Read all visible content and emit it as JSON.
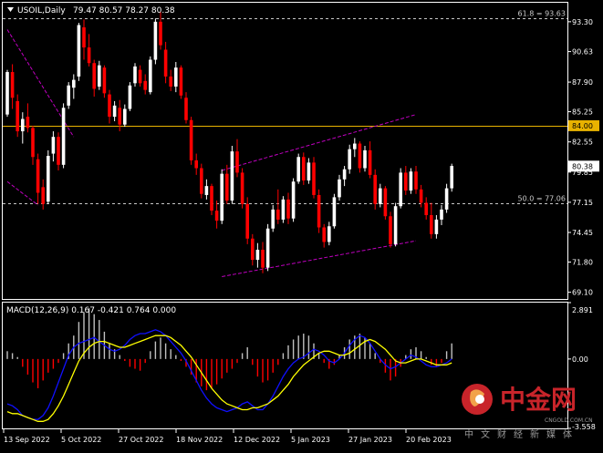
{
  "colors": {
    "background": "#000000",
    "frame": "#ffffff",
    "bull": "#ffffff",
    "bear": "#ff0000",
    "horizontal_level": "#e8b200",
    "fib_level": "#c8c8c8",
    "channel": "#c000c0",
    "macd_histogram": "#c0c0c0",
    "macd_hist_negative": "#ff0000",
    "macd_line": "#1010ff",
    "signal_line": "#ffff00",
    "axis_text": "#ffffff",
    "price_label_bg": "#ffffff",
    "level_label_bg": "#e8b200",
    "watermark_red": "#c8242a",
    "watermark_gray": "#9a9a9a"
  },
  "chart_data": [
    {
      "type": "candlestick",
      "symbol_header": "USOIL,Daily",
      "ohlc_header": "79.47 80.57 78.27 80.38",
      "yaxis_ticks": [
        "93.30",
        "90.63",
        "87.90",
        "85.25",
        "82.55",
        "79.85",
        "77.15",
        "74.45",
        "71.80",
        "69.10"
      ],
      "ylim": [
        68.5,
        95.0
      ],
      "xaxis_ticks": [
        "13 Sep 2022",
        "5 Oct 2022",
        "27 Oct 2022",
        "18 Nov 2022",
        "12 Dec 2022",
        "5 Jan 2023",
        "27 Jan 2023",
        "20 Feb 2023"
      ],
      "current_price": "80.38",
      "horizontal_levels": [
        {
          "value": 84.0,
          "label": "84.00",
          "style": "solid"
        },
        {
          "value": 93.63,
          "label": "61.8 = 93.63",
          "style": "dashed"
        },
        {
          "value": 77.06,
          "label": "50.0 = 77.06",
          "style": "dashed"
        }
      ],
      "candles": [
        [
          85.0,
          89.0,
          84.8,
          88.8
        ],
        [
          88.8,
          89.5,
          85.5,
          86.5
        ],
        [
          86.2,
          86.8,
          83.0,
          83.5
        ],
        [
          83.5,
          85.2,
          82.4,
          84.6
        ],
        [
          84.8,
          86.0,
          83.4,
          83.8
        ],
        [
          83.8,
          84.0,
          80.5,
          81.2
        ],
        [
          81.0,
          81.5,
          77.0,
          78.0
        ],
        [
          78.5,
          79.2,
          76.5,
          77.0
        ],
        [
          77.2,
          81.8,
          77.0,
          81.3
        ],
        [
          81.5,
          83.5,
          80.8,
          83.0
        ],
        [
          83.0,
          83.4,
          80.0,
          80.5
        ],
        [
          80.5,
          86.0,
          80.2,
          85.6
        ],
        [
          85.8,
          87.9,
          85.5,
          87.6
        ],
        [
          87.4,
          88.6,
          86.4,
          88.1
        ],
        [
          88.4,
          93.2,
          88.0,
          93.0
        ],
        [
          92.8,
          93.5,
          89.9,
          91.0
        ],
        [
          91.0,
          92.2,
          89.3,
          89.6
        ],
        [
          89.6,
          89.9,
          86.6,
          87.3
        ],
        [
          87.5,
          89.8,
          87.2,
          89.4
        ],
        [
          89.2,
          89.4,
          86.5,
          86.9
        ],
        [
          86.8,
          87.2,
          84.2,
          84.8
        ],
        [
          84.8,
          86.2,
          84.4,
          85.8
        ],
        [
          85.6,
          86.3,
          83.5,
          84.1
        ],
        [
          84.1,
          85.9,
          83.9,
          85.5
        ],
        [
          85.5,
          87.9,
          85.3,
          87.6
        ],
        [
          87.8,
          89.6,
          87.5,
          89.3
        ],
        [
          89.0,
          89.4,
          87.5,
          87.8
        ],
        [
          88.0,
          88.6,
          86.8,
          87.2
        ],
        [
          87.0,
          90.2,
          86.8,
          89.9
        ],
        [
          89.9,
          93.6,
          89.5,
          93.3
        ],
        [
          93.3,
          94.2,
          90.8,
          91.2
        ],
        [
          90.8,
          91.5,
          87.8,
          88.4
        ],
        [
          88.4,
          89.0,
          87.1,
          87.5
        ],
        [
          87.5,
          89.7,
          87.0,
          89.2
        ],
        [
          89.2,
          89.4,
          86.4,
          86.7
        ],
        [
          86.5,
          87.0,
          84.2,
          84.5
        ],
        [
          84.5,
          84.8,
          80.5,
          80.9
        ],
        [
          80.9,
          81.5,
          79.6,
          80.2
        ],
        [
          80.2,
          80.6,
          77.5,
          77.9
        ],
        [
          77.8,
          79.2,
          77.4,
          78.6
        ],
        [
          78.6,
          78.8,
          76.0,
          76.4
        ],
        [
          76.4,
          77.3,
          74.8,
          75.5
        ],
        [
          75.5,
          80.1,
          75.2,
          79.7
        ],
        [
          79.7,
          80.5,
          77.0,
          77.3
        ],
        [
          77.3,
          82.2,
          77.0,
          81.7
        ],
        [
          81.7,
          82.8,
          79.4,
          79.8
        ],
        [
          79.8,
          80.2,
          76.6,
          77.0
        ],
        [
          77.0,
          77.6,
          73.4,
          73.9
        ],
        [
          73.9,
          74.3,
          71.5,
          72.0
        ],
        [
          72.0,
          73.5,
          71.3,
          72.9
        ],
        [
          72.9,
          73.6,
          70.8,
          71.3
        ],
        [
          71.3,
          75.2,
          71.0,
          74.8
        ],
        [
          74.8,
          76.9,
          74.5,
          76.5
        ],
        [
          76.5,
          78.3,
          75.2,
          75.6
        ],
        [
          75.6,
          77.7,
          75.3,
          77.4
        ],
        [
          77.4,
          78.0,
          75.2,
          75.7
        ],
        [
          75.7,
          79.3,
          75.4,
          79.0
        ],
        [
          79.0,
          81.5,
          78.8,
          81.2
        ],
        [
          81.2,
          81.6,
          78.7,
          79.1
        ],
        [
          79.1,
          81.1,
          78.8,
          80.7
        ],
        [
          80.7,
          81.2,
          77.5,
          77.8
        ],
        [
          77.8,
          78.3,
          74.4,
          74.9
        ],
        [
          74.9,
          75.2,
          73.1,
          73.6
        ],
        [
          73.6,
          75.4,
          73.3,
          75.0
        ],
        [
          75.0,
          77.9,
          74.8,
          77.6
        ],
        [
          77.6,
          79.6,
          77.3,
          79.2
        ],
        [
          79.2,
          80.4,
          78.6,
          80.1
        ],
        [
          80.1,
          82.3,
          79.7,
          81.9
        ],
        [
          81.9,
          82.9,
          81.2,
          82.4
        ],
        [
          82.4,
          82.6,
          79.8,
          80.2
        ],
        [
          80.2,
          82.2,
          79.9,
          81.8
        ],
        [
          81.8,
          82.6,
          79.3,
          79.6
        ],
        [
          79.6,
          80.1,
          76.5,
          77.0
        ],
        [
          77.0,
          78.8,
          76.7,
          78.4
        ],
        [
          78.4,
          78.6,
          75.6,
          75.9
        ],
        [
          75.9,
          76.3,
          73.1,
          73.4
        ],
        [
          73.4,
          77.1,
          73.2,
          76.8
        ],
        [
          76.8,
          80.2,
          76.6,
          79.8
        ],
        [
          79.8,
          80.4,
          77.8,
          78.2
        ],
        [
          78.2,
          80.2,
          77.9,
          79.9
        ],
        [
          79.9,
          80.4,
          77.9,
          78.3
        ],
        [
          78.3,
          78.7,
          76.7,
          77.1
        ],
        [
          77.1,
          77.6,
          75.6,
          76.0
        ],
        [
          76.0,
          77.1,
          73.9,
          74.3
        ],
        [
          74.3,
          76.0,
          73.9,
          75.6
        ],
        [
          75.6,
          76.9,
          75.1,
          76.5
        ],
        [
          76.5,
          78.8,
          76.2,
          78.4
        ],
        [
          78.4,
          80.6,
          78.1,
          80.4
        ]
      ]
    },
    {
      "type": "macd",
      "title": "MACD(12,26,9) 0.167 -0.421 0.764 0.000",
      "yaxis_ticks": [
        "2.891",
        "0.00",
        "-3.558"
      ],
      "ylim": [
        -3.558,
        2.891
      ],
      "histogram": [
        0.4,
        0.3,
        0.1,
        -0.4,
        -0.8,
        -1.2,
        -1.5,
        -1.1,
        -0.7,
        -0.5,
        -0.2,
        0.3,
        0.8,
        1.2,
        1.9,
        2.4,
        2.6,
        2.3,
        2.0,
        1.4,
        0.8,
        0.5,
        0.2,
        -0.1,
        -0.4,
        -0.5,
        -0.6,
        -0.2,
        0.4,
        0.9,
        1.1,
        0.8,
        0.5,
        0.2,
        -0.1,
        -0.4,
        -0.8,
        -1.2,
        -1.4,
        -1.6,
        -1.5,
        -1.3,
        -1.0,
        -0.7,
        -0.5,
        -0.2,
        0.3,
        0.6,
        -0.3,
        -0.9,
        -1.2,
        -1.1,
        -0.7,
        -0.3,
        0.3,
        0.7,
        1.0,
        1.2,
        1.3,
        1.2,
        0.8,
        0.3,
        -0.2,
        -0.5,
        -0.3,
        0.2,
        0.6,
        1.0,
        1.2,
        1.3,
        1.1,
        0.8,
        0.3,
        -0.2,
        -0.7,
        -1.1,
        -0.9,
        -0.4,
        0.2,
        0.5,
        0.6,
        0.4,
        0.1,
        -0.3,
        -0.4,
        -0.2,
        0.4,
        0.8
      ],
      "macd": [
        -2.3,
        -2.4,
        -2.6,
        -2.9,
        -3.0,
        -3.1,
        -3.1,
        -2.9,
        -2.5,
        -1.9,
        -1.2,
        -0.5,
        0.2,
        0.6,
        0.8,
        0.9,
        1.0,
        1.1,
        0.9,
        0.7,
        0.5,
        0.4,
        0.5,
        0.7,
        1.0,
        1.2,
        1.3,
        1.3,
        1.4,
        1.5,
        1.4,
        1.2,
        0.9,
        0.6,
        0.3,
        -0.1,
        -0.6,
        -1.1,
        -1.6,
        -2.0,
        -2.3,
        -2.5,
        -2.6,
        -2.7,
        -2.6,
        -2.5,
        -2.3,
        -2.2,
        -2.4,
        -2.6,
        -2.6,
        -2.3,
        -1.9,
        -1.4,
        -0.9,
        -0.5,
        -0.2,
        0.0,
        0.1,
        0.3,
        0.5,
        0.4,
        0.2,
        -0.1,
        -0.2,
        0.0,
        0.3,
        0.7,
        1.0,
        1.2,
        1.1,
        0.8,
        0.4,
        0.0,
        -0.3,
        -0.5,
        -0.4,
        -0.2,
        0.0,
        0.2,
        0.1,
        -0.1,
        -0.3,
        -0.4,
        -0.4,
        -0.3,
        -0.2,
        0.0
      ],
      "signal": [
        -2.7,
        -2.8,
        -2.8,
        -2.9,
        -3.0,
        -3.1,
        -3.2,
        -3.2,
        -3.1,
        -2.8,
        -2.4,
        -1.9,
        -1.3,
        -0.7,
        -0.1,
        0.3,
        0.6,
        0.8,
        0.9,
        0.9,
        0.8,
        0.7,
        0.6,
        0.6,
        0.7,
        0.8,
        0.9,
        1.0,
        1.1,
        1.2,
        1.2,
        1.2,
        1.1,
        0.9,
        0.7,
        0.4,
        0.1,
        -0.3,
        -0.7,
        -1.1,
        -1.5,
        -1.8,
        -2.1,
        -2.3,
        -2.4,
        -2.5,
        -2.6,
        -2.6,
        -2.5,
        -2.5,
        -2.4,
        -2.3,
        -2.1,
        -1.9,
        -1.6,
        -1.3,
        -0.9,
        -0.6,
        -0.3,
        -0.1,
        0.1,
        0.3,
        0.4,
        0.4,
        0.3,
        0.2,
        0.2,
        0.3,
        0.5,
        0.7,
        0.9,
        1.0,
        0.9,
        0.7,
        0.5,
        0.2,
        -0.1,
        -0.2,
        -0.2,
        -0.1,
        0.0,
        0.0,
        -0.1,
        -0.2,
        -0.3,
        -0.3,
        -0.3,
        -0.2
      ]
    }
  ],
  "watermark": {
    "brand": "中金网",
    "domain": "CNGOLD.COM.CN",
    "tagline": "中文财经新媒体"
  }
}
